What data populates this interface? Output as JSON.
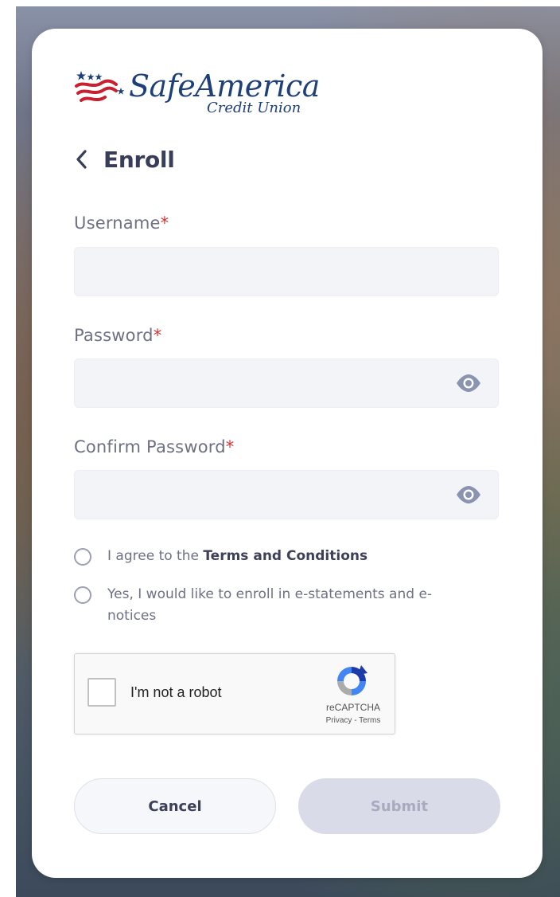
{
  "brand": {
    "name": "SafeAmerica",
    "sub": "Credit Union"
  },
  "header": {
    "title": "Enroll"
  },
  "form": {
    "username": {
      "label": "Username",
      "required_mark": "*",
      "value": ""
    },
    "password": {
      "label": "Password",
      "required_mark": "*",
      "value": ""
    },
    "confirm_password": {
      "label": "Confirm Password",
      "required_mark": "*",
      "value": ""
    },
    "terms": {
      "prefix": "I agree to the ",
      "link": "Terms and Conditions",
      "checked": false
    },
    "estatements": {
      "label": "Yes, I would like to enroll in e-statements and e-notices",
      "checked": false
    }
  },
  "recaptcha": {
    "label": "I'm not a robot",
    "brand": "reCAPTCHA",
    "links": "Privacy - Terms"
  },
  "buttons": {
    "cancel": "Cancel",
    "submit": "Submit"
  },
  "icons": {
    "back": "chevron-left-icon",
    "password_toggle": "eye-icon",
    "logo": "flag-stars-icon",
    "recaptcha": "recaptcha-icon"
  },
  "colors": {
    "brand_blue": "#1d3f7a",
    "brand_red": "#c8202f",
    "title": "#383d5a",
    "required": "#d13434",
    "submit_disabled_bg": "#d9dbe8",
    "field_bg": "#f3f4f8"
  }
}
